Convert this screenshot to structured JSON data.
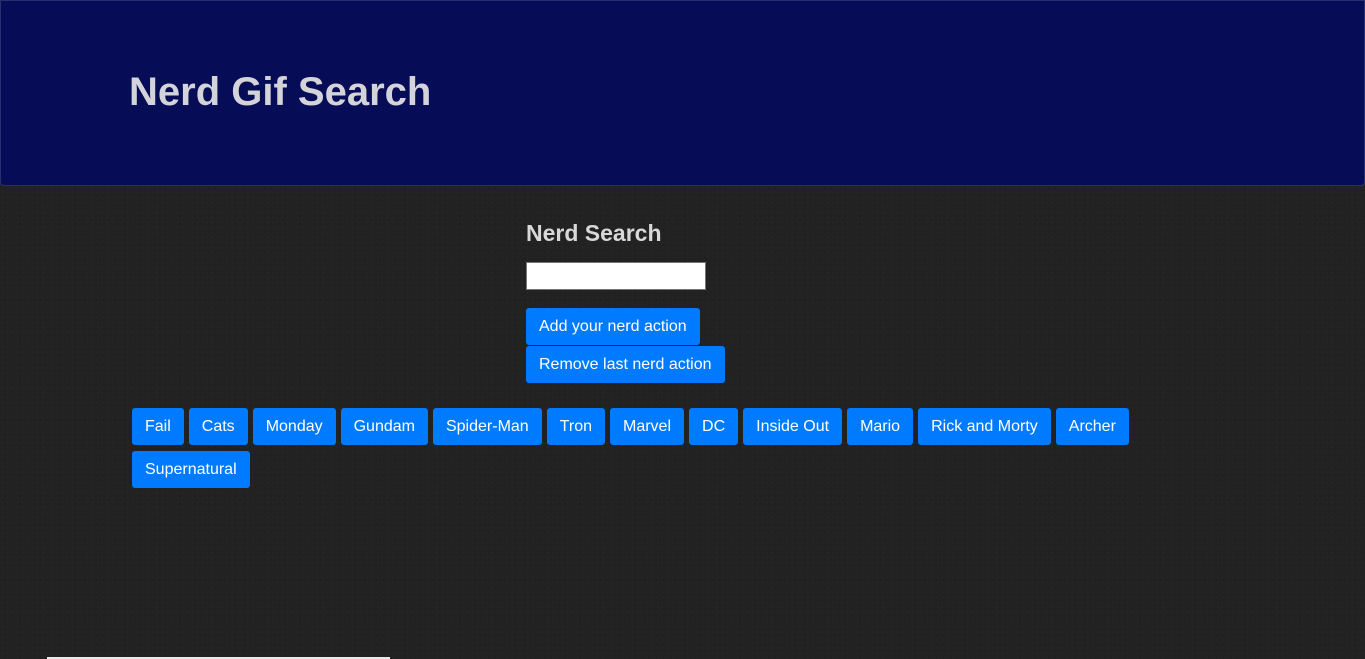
{
  "header": {
    "title": "Nerd Gif Search"
  },
  "search": {
    "heading": "Nerd Search",
    "input_value": "",
    "placeholder": "",
    "add_label": "Add your nerd action",
    "remove_label": "Remove last nerd action"
  },
  "actions": [
    "Fail",
    "Cats",
    "Monday",
    "Gundam",
    "Spider-Man",
    "Tron",
    "Marvel",
    "DC",
    "Inside Out",
    "Mario",
    "Rick and Morty",
    "Archer",
    "Supernatural"
  ],
  "colors": {
    "header_bg": "#060c55",
    "page_bg": "#222222",
    "button_bg": "#007bff",
    "button_text": "#ffffff",
    "title_text": "#d3d3d9"
  }
}
